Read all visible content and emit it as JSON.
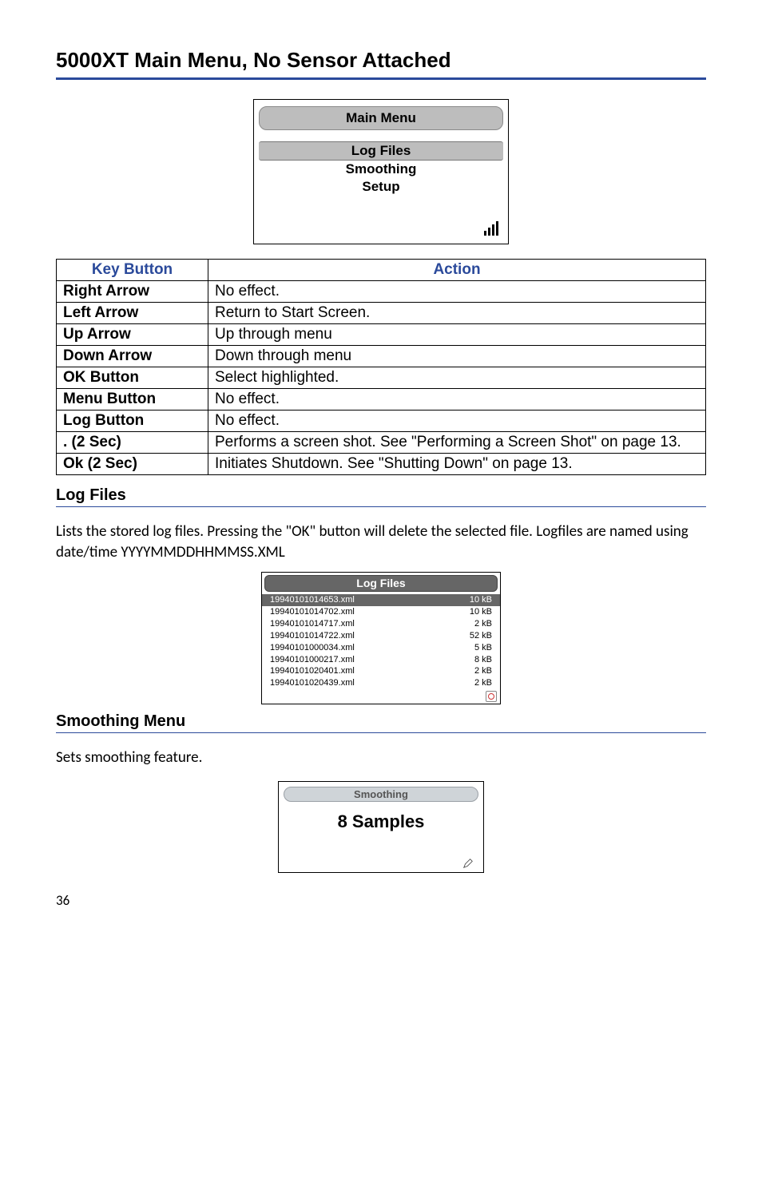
{
  "page": {
    "title": "5000XT Main Menu, No Sensor Attached",
    "number": "36"
  },
  "main_menu_device": {
    "header": "Main Menu",
    "items": [
      {
        "label": "Log Files",
        "selected": true
      },
      {
        "label": "Smoothing",
        "selected": false
      },
      {
        "label": "Setup",
        "selected": false
      }
    ]
  },
  "key_table": {
    "headers": {
      "key": "Key Button",
      "action": "Action"
    },
    "rows": [
      {
        "key": "Right Arrow",
        "action": "No effect."
      },
      {
        "key": "Left Arrow",
        "action": "Return to Start Screen."
      },
      {
        "key": "Up Arrow",
        "action": "Up through menu"
      },
      {
        "key": "Down Arrow",
        "action": "Down through menu"
      },
      {
        "key": "OK Button",
        "action": "Select highlighted."
      },
      {
        "key": "Menu Button",
        "action": "No effect."
      },
      {
        "key": "Log Button",
        "action": "No effect."
      },
      {
        "key": ". (2 Sec)",
        "action": "Performs a screen shot. See \"Performing a Screen Shot\" on page 13."
      },
      {
        "key": "Ok (2 Sec)",
        "action": "Initiates Shutdown. See \"Shutting Down\" on page 13."
      }
    ]
  },
  "log_files_section": {
    "heading": "Log Files",
    "body": "Lists the stored log files. Pressing the \"OK\" button will delete the selected file. Logfiles are named using date/time YYYYMMDDHHMMSS.XML",
    "device": {
      "header": "Log Files",
      "rows": [
        {
          "name": "19940101014653.xml",
          "size": "10 kB",
          "selected": true
        },
        {
          "name": "19940101014702.xml",
          "size": "10 kB",
          "selected": false
        },
        {
          "name": "19940101014717.xml",
          "size": "2 kB",
          "selected": false
        },
        {
          "name": "19940101014722.xml",
          "size": "52 kB",
          "selected": false
        },
        {
          "name": "19940101000034.xml",
          "size": "5 kB",
          "selected": false
        },
        {
          "name": "19940101000217.xml",
          "size": "8 kB",
          "selected": false
        },
        {
          "name": "19940101020401.xml",
          "size": "2 kB",
          "selected": false
        },
        {
          "name": "19940101020439.xml",
          "size": "2 kB",
          "selected": false
        }
      ]
    }
  },
  "smoothing_section": {
    "heading": "Smoothing Menu",
    "body": "Sets smoothing feature.",
    "device": {
      "header": "Smoothing",
      "value": "8 Samples"
    }
  }
}
